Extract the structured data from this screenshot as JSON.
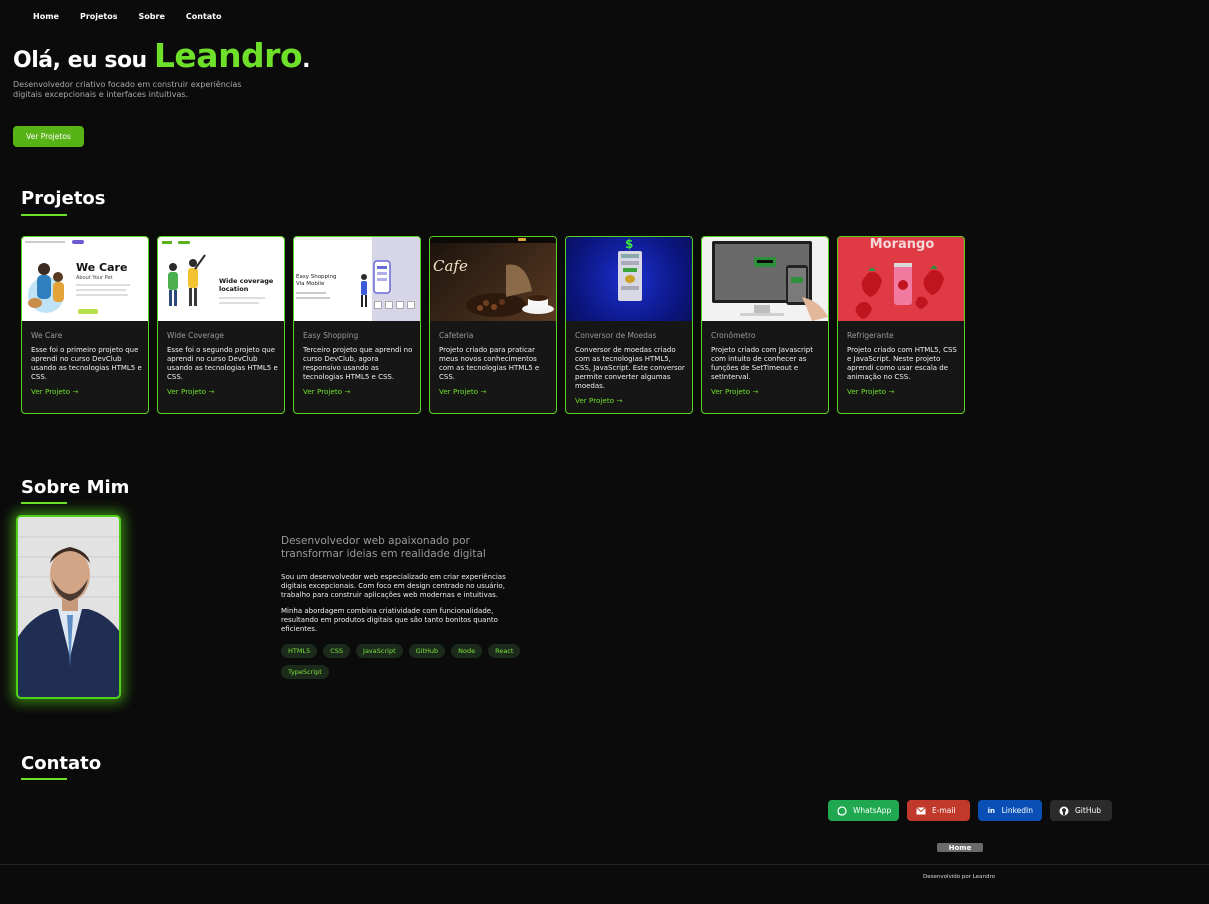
{
  "nav": {
    "items": [
      "Home",
      "Projetos",
      "Sobre",
      "Contato"
    ]
  },
  "hero": {
    "greeting": "Olá, eu sou",
    "name": "Leandro",
    "dot": ".",
    "description": "Desenvolvedor criativo focado em construir experiências digitais excepcionais e interfaces intuitivas.",
    "cta": "Ver Projetos"
  },
  "projects": {
    "title": "Projetos",
    "link_label": "Ver Projeto →",
    "items": [
      {
        "title": "We Care",
        "description": "Esse foi o primeiro projeto que aprendi no curso DevClub usando as tecnologias HTML5 e CSS.",
        "thumb_headline": "We Care",
        "thumb_sub": "About Your Pet",
        "thumb_icon": "pet-care-illustration"
      },
      {
        "title": "Wide Coverage",
        "description": "Esse foi o segundo projeto que aprendi no curso DevClub usando as tecnologias HTML5 e CSS.",
        "thumb_headline": "Wide coverage location",
        "thumb_icon": "people-illustration"
      },
      {
        "title": "Easy Shopping",
        "description": "Terceiro projeto que aprendi no curso DevClub, agora responsivo usando as tecnologias HTML5 e CSS.",
        "thumb_headline": "Easy Shopping Via Mobile",
        "thumb_icon": "phone-illustration"
      },
      {
        "title": "Cafeteria",
        "description": "Projeto criado para praticar meus novos conhecimentos com as tecnologias HTML5 e CSS.",
        "thumb_headline": "Cafe",
        "thumb_icon": "coffee-photo"
      },
      {
        "title": "Conversor de Moedas",
        "description": "Conversor de moedas criado com as tecnologias HTML5, CSS, JavaScript. Este conversor permite converter algumas moedas.",
        "thumb_headline": "$",
        "thumb_icon": "currency-app"
      },
      {
        "title": "Cronômetro",
        "description": "Projeto criado com Javascript com intuito de conhecer as funções de SetTimeout e setInterval.",
        "thumb_icon": "monitor-phone-photo"
      },
      {
        "title": "Refrigerante",
        "description": "Projeto criado com HTML5, CSS e JavaScript. Neste projeto aprendi como usar escala de animação no CSS.",
        "thumb_headline": "Morango",
        "thumb_icon": "soda-can-strawberry"
      }
    ]
  },
  "about": {
    "title": "Sobre Mim",
    "headline": "Desenvolvedor web apaixonado por transformar ideias em realidade digital",
    "p1": "Sou um desenvolvedor web especializado em criar experiências digitais excepcionais. Com foco em design centrado no usuário, trabalho para construir aplicações web modernas e intuitivas.",
    "p2": "Minha abordagem combina criatividade com funcionalidade, resultando em produtos digitais que são tanto bonitos quanto eficientes.",
    "tags": [
      "HTML5",
      "CSS",
      "JavaScript",
      "GitHub",
      "Node",
      "React",
      "TypeScript"
    ]
  },
  "contact": {
    "title": "Contato",
    "buttons": [
      {
        "label": "WhatsApp",
        "icon": "whatsapp-icon",
        "color": "#1fa84f"
      },
      {
        "label": "E-mail",
        "icon": "email-icon",
        "color": "#c0392b"
      },
      {
        "label": "LinkedIn",
        "icon": "linkedin-icon",
        "color": "#0a4fb5"
      },
      {
        "label": "GitHub",
        "icon": "github-icon",
        "color": "#2b2b2b"
      }
    ]
  },
  "footer": {
    "home_button": "Home",
    "credit": "Desenvolvido por Leandro"
  },
  "colors": {
    "accent": "#6ee02a",
    "background": "#0b0b0b",
    "card": "#161616"
  }
}
